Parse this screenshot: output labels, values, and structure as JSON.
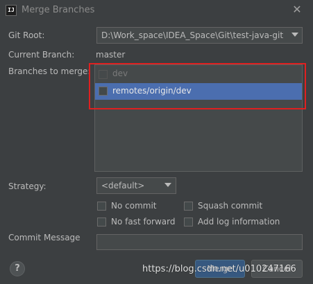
{
  "window": {
    "title": "Merge Branches",
    "icon": "intellij-icon",
    "icon_text": "IJ",
    "close_glyph": "✕"
  },
  "form": {
    "git_root_label": "Git Root:",
    "git_root_value": "D:\\Work_space\\IDEA_Space\\Git\\test-java-git",
    "current_branch_label": "Current Branch:",
    "current_branch_value": "master",
    "branches_label": "Branches to merge:",
    "branches": [
      {
        "name": "dev",
        "checked": false,
        "enabled": false,
        "selected": false
      },
      {
        "name": "remotes/origin/dev",
        "checked": false,
        "enabled": true,
        "selected": true
      }
    ],
    "strategy_label": "Strategy:",
    "strategy_value": "<default>",
    "options": {
      "no_commit": "No commit",
      "squash_commit": "Squash commit",
      "no_fast_forward": "No fast forward",
      "add_log_information": "Add log information"
    },
    "commit_message_label": "Commit Message",
    "commit_message_value": ""
  },
  "footer": {
    "help_glyph": "?",
    "merge_label": "Merge",
    "cancel_label": "Cancel"
  },
  "watermark": "https://blog.csdn.net/u010247166",
  "colors": {
    "background": "#3c3f41",
    "selection": "#4b6eaf",
    "highlight_box": "#e02020"
  }
}
